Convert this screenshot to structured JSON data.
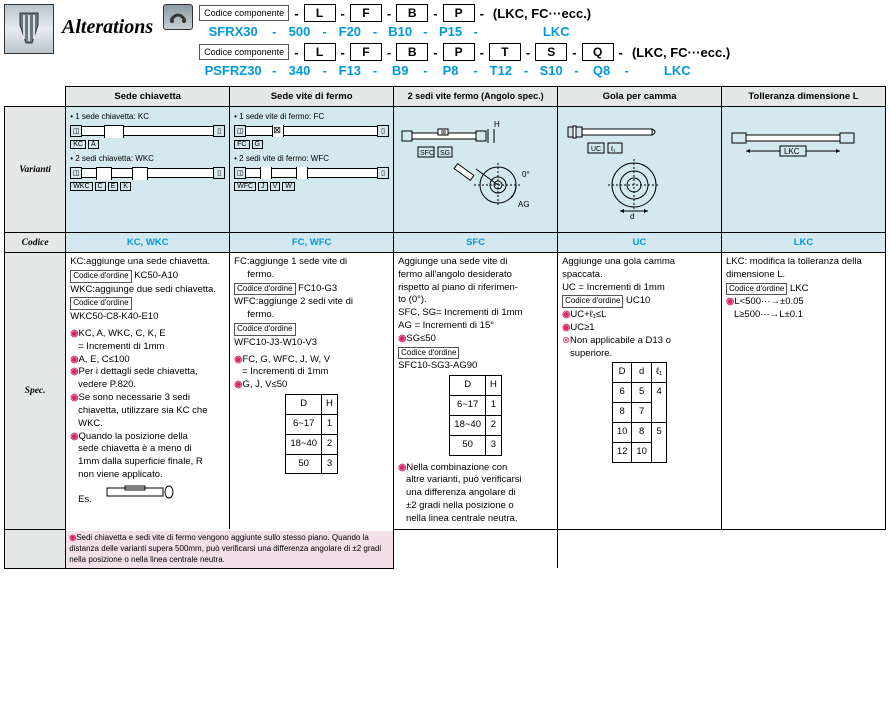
{
  "header": {
    "alterations": "Alterations",
    "code_label": "Codice componente",
    "slots1": [
      "L",
      "F",
      "B",
      "P"
    ],
    "paren1": "(LKC, FC···ecc.)",
    "vals1_code": "SFRX30",
    "vals1": [
      "500",
      "F20",
      "B10",
      "P15"
    ],
    "vals1_end": "LKC",
    "slots2": [
      "L",
      "F",
      "B",
      "P",
      "T",
      "S",
      "Q"
    ],
    "paren2": "(LKC, FC···ecc.)",
    "vals2_code": "PSFRZ30",
    "vals2": [
      "340",
      "F13",
      "B9",
      "P8",
      "T12",
      "S10",
      "Q8"
    ],
    "vals2_end": "LKC"
  },
  "rows": {
    "varianti": "Varianti",
    "codice": "Codice",
    "spec": "Spec."
  },
  "cols": {
    "c1": "Sede chiavetta",
    "c2": "Sede vite di fermo",
    "c3": "2 sedi vite fermo (Angolo spec.)",
    "c4": "Gola per camma",
    "c5": "Tolleranza dimensione L"
  },
  "variants": {
    "c1a": "• 1 sede chiavetta: KC",
    "c1a_lbl": [
      "KC",
      "A"
    ],
    "c1b": "• 2 sedi chiavetta: WKC",
    "c1b_lbl": [
      "WKC",
      "C",
      "E",
      "K"
    ],
    "c2a": "• 1 sede vite di fermo: FC",
    "c2a_lbl": [
      "FC",
      "G"
    ],
    "c2b": "• 2 sedi vite di fermo: WFC",
    "c2b_lbl": [
      "WFC",
      "J",
      "V",
      "W"
    ],
    "c3_lbl": [
      "SFC",
      "SG"
    ],
    "c3_h": "H",
    "c3_ag": "AG",
    "c4_lbl": [
      "UC",
      "ℓ₁"
    ],
    "c4_d": "d",
    "c5_lbl": "LKC"
  },
  "codes": {
    "c1": "KC, WKC",
    "c2": "FC, WFC",
    "c3": "SFC",
    "c4": "UC",
    "c5": "LKC"
  },
  "spec": {
    "ord": "Codice d'ordine",
    "c1": {
      "l1": "KC:aggiunge una sede chiavetta.",
      "o1": "KC50-A10",
      "l2": "WKC:aggiunge due sedi chiavetta.",
      "o2": "WKC50-C8-K40-E10",
      "b1": "KC, A, WKC, C, K, E",
      "b1b": "= Incrementi di 1mm",
      "b2": "A, E, C≤100",
      "b3": "Per i dettagli sede chiavetta,",
      "b3b": "vedere P.820.",
      "b4": "Se sono necessarie 3 sedi",
      "b4b": "chiavetta, utilizzare sia KC che",
      "b4c": "WKC.",
      "b5": "Quando la posizione della",
      "b5b": "sede chiavetta è a meno di",
      "b5c": "1mm dalla superficie finale, R",
      "b5d": "non viene applicato.",
      "b5e": "Es."
    },
    "c2": {
      "l1": "FC:aggiunge 1 sede vite di",
      "l1b": "fermo.",
      "o1": "FC10-G3",
      "l2": "WFC:aggiunge 2 sedi vite di",
      "l2b": "fermo.",
      "o2": "WFC10-J3-W10-V3",
      "b1": "FC, G, WFC, J, W, V",
      "b1b": "= Incrementi di 1mm",
      "b2": "G, J, V≤50",
      "tbl": [
        [
          "D",
          "H"
        ],
        [
          "6~17",
          "1"
        ],
        [
          "18~40",
          "2"
        ],
        [
          "50",
          "3"
        ]
      ]
    },
    "c3": {
      "l1": "Aggiunge una sede vite di",
      "l2": "fermo all'angolo desiderato",
      "l3": "rispetto al piano di riferimen-",
      "l4": "to (0°).",
      "l5": "SFC, SG= Incrementi di 1mm",
      "l6": "AG = Incrementi di 15°",
      "b1": "SG≤50",
      "o1": "SFC10-SG3-AG90",
      "tbl": [
        [
          "D",
          "H"
        ],
        [
          "6~17",
          "1"
        ],
        [
          "18~40",
          "2"
        ],
        [
          "50",
          "3"
        ]
      ],
      "n1": "Nella combinazione con",
      "n2": "altre varianti, può verificarsi",
      "n3": "una differenza angolare di",
      "n4": "±2 gradi nella posizione o",
      "n5": "nella linea centrale neutra."
    },
    "c4": {
      "l1": "Aggiunge una gola camma",
      "l2": "spaccata.",
      "l3": "UC = Incrementi di 1mm",
      "o1": "UC10",
      "b1": "UC+ℓ₁≤L",
      "b2": "UC≥1",
      "x1": "Non applicabile a D13 o",
      "x2": "superiore.",
      "tbl": [
        [
          "D",
          "d",
          "ℓ₁"
        ],
        [
          "6",
          "5",
          "4"
        ],
        [
          "8",
          "7",
          "4"
        ],
        [
          "10",
          "8",
          "5"
        ],
        [
          "12",
          "10",
          "5"
        ]
      ]
    },
    "c5": {
      "l1": "LKC: modifica la tolleranza della",
      "l2": "dimensione L.",
      "o1": "LKC",
      "b1": "L<500···→±0.05",
      "b2": "L≥500···→L±0.1"
    },
    "foot": "Sedi chiavetta e sedi vite di fermo vengono aggiunte sullo stesso piano. Quando la distanza delle varianti supera 500mm, può verificarsi una differenza angolare di ±2 gradi nella posizione o nella linea centrale neutra."
  }
}
